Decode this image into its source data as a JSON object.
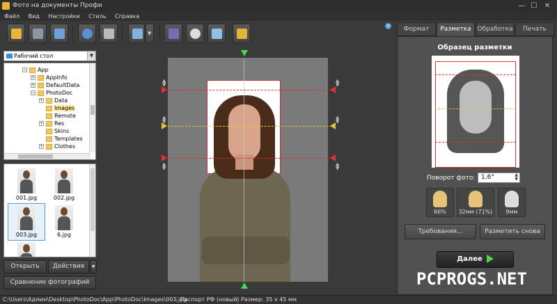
{
  "window": {
    "title": "Фото на документы Профи"
  },
  "menu": [
    "Файл",
    "Вид",
    "Настройки",
    "Стиль",
    "Справка"
  ],
  "folder_select": {
    "value": "Рабочий стол"
  },
  "tree": [
    {
      "label": "App",
      "expander": "−"
    },
    {
      "label": "AppInfo",
      "expander": "+"
    },
    {
      "label": "DefaultData",
      "expander": "+"
    },
    {
      "label": "PhotoDoc",
      "expander": "−"
    },
    {
      "label": "Data",
      "expander": "+"
    },
    {
      "label": "Images",
      "expander": "",
      "selected": true
    },
    {
      "label": "Remote",
      "expander": ""
    },
    {
      "label": "Res",
      "expander": "+"
    },
    {
      "label": "Skins",
      "expander": ""
    },
    {
      "label": "Templates",
      "expander": ""
    },
    {
      "label": "Clothes",
      "expander": "+"
    }
  ],
  "thumbnails": [
    {
      "label": "001.jpg"
    },
    {
      "label": "002.jpg"
    },
    {
      "label": "003.jpg",
      "selected": true
    },
    {
      "label": "6.jpg"
    }
  ],
  "left_buttons": {
    "open": "Открыть",
    "actions": "Действия",
    "actions_arrow": "▼",
    "compare": "Сравнение фотографий"
  },
  "tabs": [
    {
      "label": "Формат"
    },
    {
      "label": "Разметка",
      "active": true
    },
    {
      "label": "Обработка"
    },
    {
      "label": "Печать"
    }
  ],
  "markup": {
    "title": "Образец разметки",
    "rotation_label": "Поворот фото:",
    "rotation_value": "1,6°",
    "metrics": [
      {
        "value": "66%",
        "icon": "head-size-icon"
      },
      {
        "value": "32мм (71%)",
        "icon": "face-height-icon"
      },
      {
        "value": "9мм",
        "icon": "top-margin-icon"
      }
    ],
    "requirements_button": "Требования...",
    "remark_button": "Разметить снова",
    "next_button": "Далее"
  },
  "watermark": "PCPROGS.NET",
  "status": {
    "path": "C:\\Users\\Админ\\Desktop\\PhotoDoc\\App\\PhotoDoc\\Images\\003.jpg",
    "format": "Паспорт РФ (новый)",
    "size": "Размер: 35 x 45 мм"
  },
  "colors": {
    "guide_red": "#dd3333",
    "guide_yellow": "#e2c23a",
    "accent_green": "#4cd84c"
  }
}
